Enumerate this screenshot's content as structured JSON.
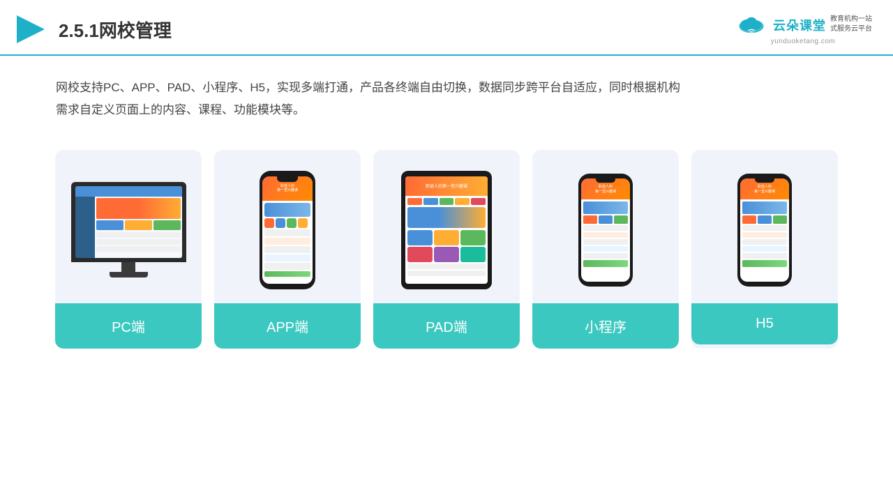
{
  "header": {
    "title": "2.5.1网校管理",
    "logo_text": "云朵课堂",
    "logo_pinyin": "yunduoketang.com",
    "logo_slogan": "教育机构一站\n式服务云平台"
  },
  "description": "网校支持PC、APP、PAD、小程序、H5，实现多端打通，产品各终端自由切换，数据同步跨平台自适应，同时根据机构\n需求自定义页面上的内容、课程、功能模块等。",
  "cards": [
    {
      "id": "pc",
      "label": "PC端"
    },
    {
      "id": "app",
      "label": "APP端"
    },
    {
      "id": "pad",
      "label": "PAD端"
    },
    {
      "id": "miniprogram",
      "label": "小程序"
    },
    {
      "id": "h5",
      "label": "H5"
    }
  ]
}
